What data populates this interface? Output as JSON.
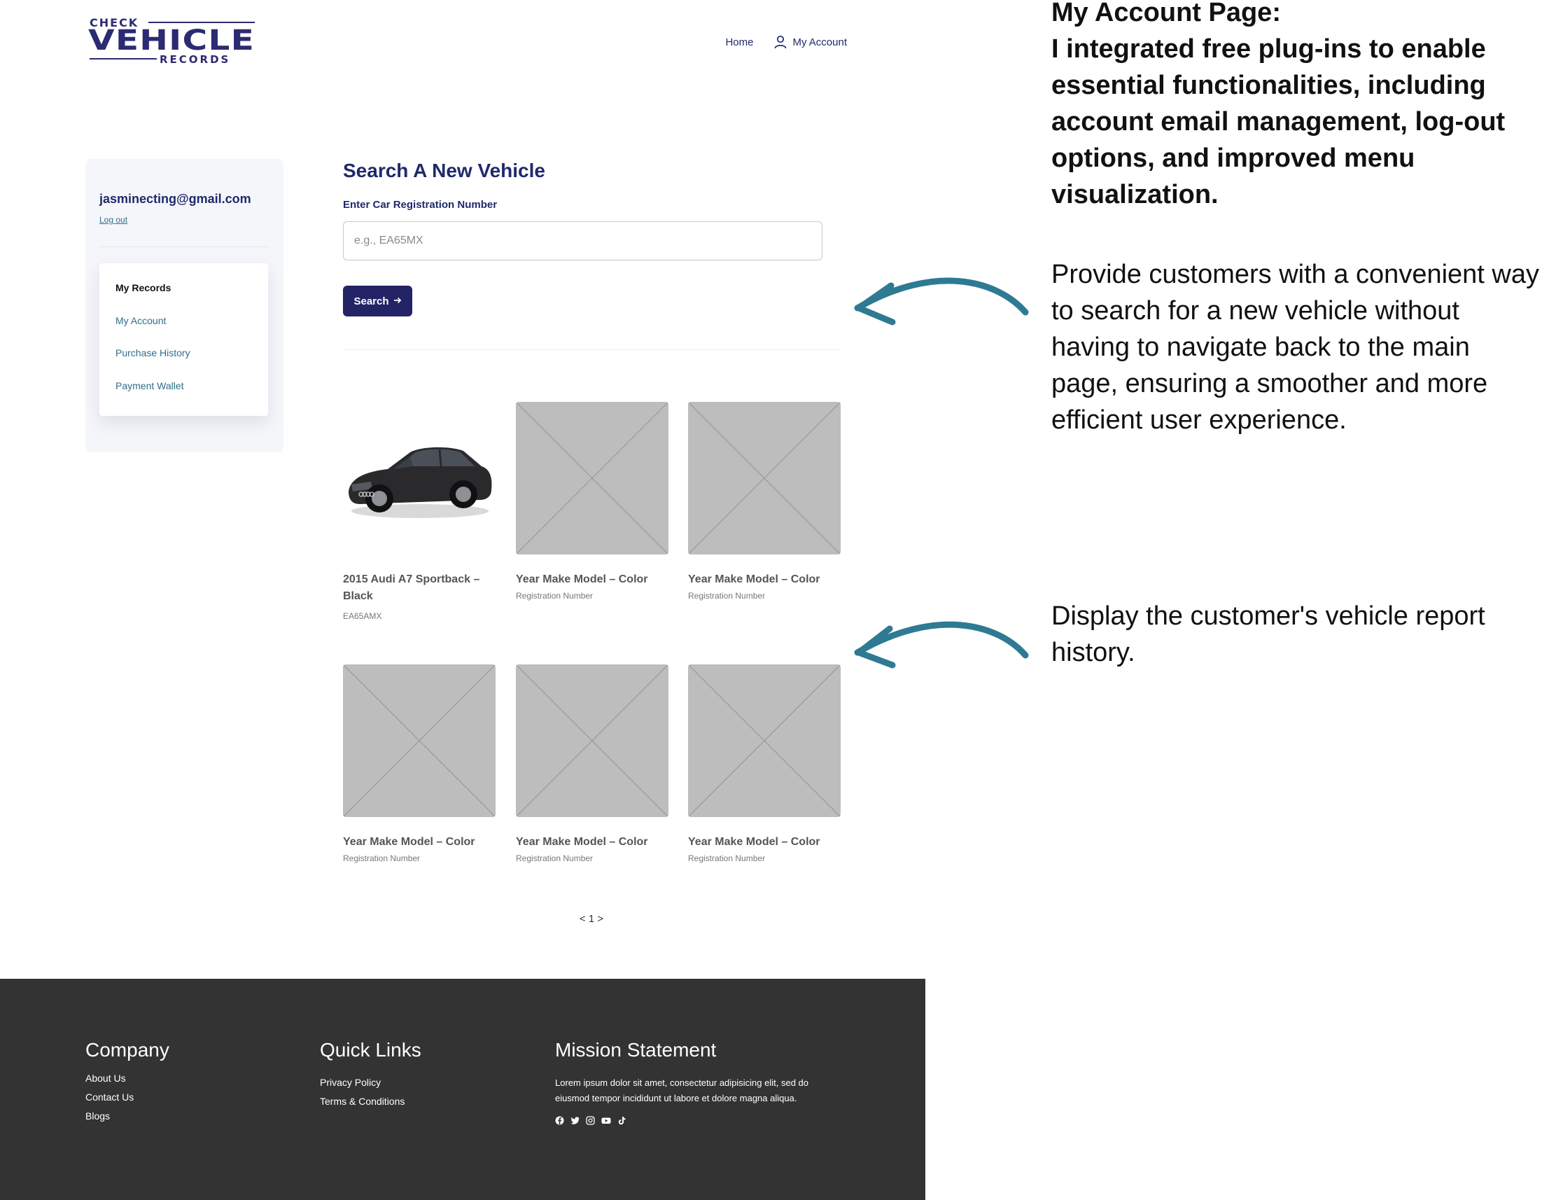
{
  "header": {
    "logo": {
      "top": "CHECK",
      "middle": "VEHICLE",
      "bottom": "RECORDS"
    },
    "nav": [
      {
        "label": "Home",
        "icon": ""
      },
      {
        "label": "My Account",
        "icon": "user-icon"
      }
    ]
  },
  "sidebar": {
    "email": "jasminecting@gmail.com",
    "logout": "Log out",
    "menu": [
      {
        "label": "My Records",
        "active": true
      },
      {
        "label": "My Account",
        "active": false
      },
      {
        "label": "Purchase History",
        "active": false
      },
      {
        "label": "Payment Wallet",
        "active": false
      }
    ]
  },
  "main": {
    "title": "Search A New Vehicle",
    "field_label": "Enter Car Registration Number",
    "input_placeholder": "e.g., EA65MX",
    "search_label": "Search",
    "search_icon": "arrow-right-icon",
    "vehicles": [
      {
        "title": "2015 Audi A7 Sportback – Black",
        "sub": "EA65AMX",
        "image": "car-photo"
      },
      {
        "title": "Year Make Model – Color",
        "sub": "Registration Number",
        "image": "placeholder"
      },
      {
        "title": "Year Make Model – Color",
        "sub": "Registration Number",
        "image": "placeholder"
      },
      {
        "title": "Year Make Model – Color",
        "sub": "Registration Number",
        "image": "placeholder"
      },
      {
        "title": "Year Make Model – Color",
        "sub": "Registration Number",
        "image": "placeholder"
      },
      {
        "title": "Year Make Model – Color",
        "sub": "Registration Number",
        "image": "placeholder"
      }
    ],
    "pagination": "< 1 >"
  },
  "footer": {
    "company": {
      "title": "Company",
      "links": [
        "About Us",
        "Contact Us",
        "Blogs"
      ]
    },
    "quick_links": {
      "title": "Quick Links",
      "links": [
        "Privacy Policy",
        "Terms & Conditions"
      ]
    },
    "mission": {
      "title": "Mission Statement",
      "text": "Lorem ipsum dolor sit amet, consectetur adipisicing elit, sed do eiusmod tempor incididunt ut labore et dolore magna aliqua.",
      "social": [
        "facebook-icon",
        "twitter-icon",
        "instagram-icon",
        "youtube-icon",
        "tiktok-icon"
      ]
    }
  },
  "annotations": {
    "title": "My Account Page:\nI integrated free plug-ins to enable essential functionalities, including account email management, log-out options, and improved menu visualization.",
    "note_search": "Provide customers with a convenient way to search for a new vehicle without having to navigate back to the main page, ensuring a smoother and more efficient user experience.",
    "note_history": "Display the customer's vehicle report history."
  },
  "colors": {
    "brand": "#232366",
    "link": "#2f6e8a",
    "footer_bg": "#333333",
    "arrow": "#2e7a93",
    "placeholder": "#bdbdbd",
    "sidebar_bg": "#f4f6fa"
  }
}
